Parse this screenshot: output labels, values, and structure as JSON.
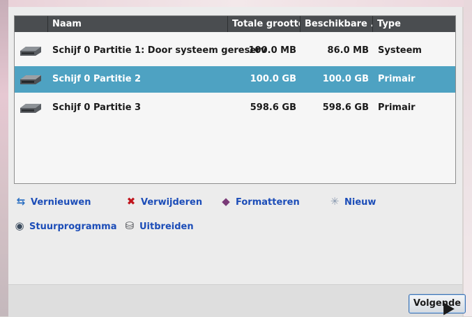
{
  "table": {
    "columns": [
      "Naam",
      "Totale grootte",
      "Beschikbare ...",
      "Type"
    ],
    "rows": [
      {
        "name": "Schijf 0 Partitie 1: Door systeem gereserv",
        "total": "100.0 MB",
        "free": "86.0 MB",
        "type": "Systeem"
      },
      {
        "name": "Schijf 0 Partitie 2",
        "total": "100.0 GB",
        "free": "100.0 GB",
        "type": "Primair"
      },
      {
        "name": "Schijf 0 Partitie 3",
        "total": "598.6 GB",
        "free": "598.6 GB",
        "type": "Primair"
      }
    ],
    "selected_row": "Schijf 0 Partitie 2"
  },
  "actions": {
    "refresh": "Vernieuwen",
    "delete": "Verwijderen",
    "format": "Formatteren",
    "new": "Nieuw",
    "driver": "Stuurprogramma",
    "extend": "Uitbreiden"
  },
  "icons": {
    "refresh": "refresh-arrows-icon",
    "delete": "red-x-icon",
    "format": "eraser-icon",
    "new": "star-burst-icon",
    "driver": "globe-disc-icon",
    "extend": "extend-disk-icon",
    "disk": "hard-disk-icon"
  },
  "colors": {
    "header": "#4a4d50",
    "selected_row": "#4ea2c2",
    "link": "#1c4db8",
    "delete_x": "#c0141c"
  },
  "footer": {
    "next_button": "Volgende"
  }
}
